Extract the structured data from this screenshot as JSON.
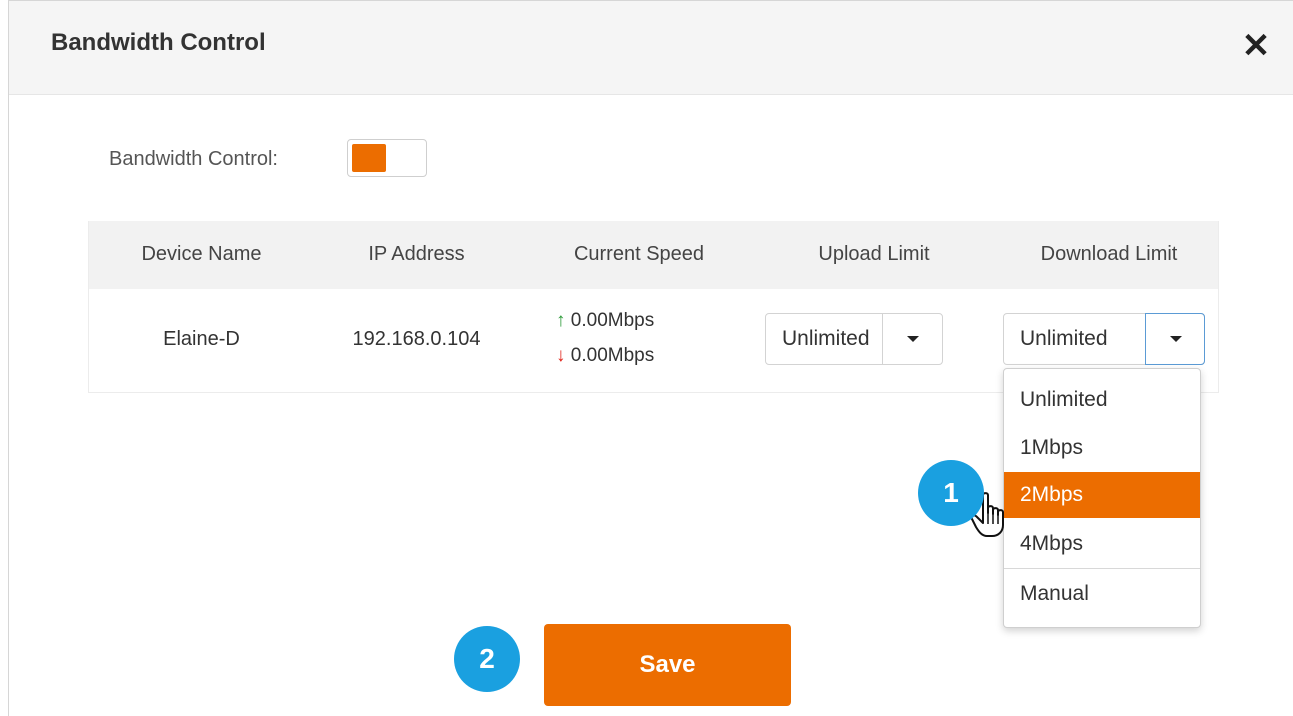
{
  "dialog": {
    "title": "Bandwidth Control",
    "close_icon": "close-icon"
  },
  "settings": {
    "bandwidth_label": "Bandwidth Control:",
    "toggle_state": "on",
    "accent_color": "#ec6d00"
  },
  "table": {
    "headers": [
      "Device Name",
      "IP Address",
      "Current Speed",
      "Upload Limit",
      "Download Limit"
    ],
    "rows": [
      {
        "device_name": "Elaine-D",
        "ip_address": "192.168.0.104",
        "upload_speed": "0.00Mbps",
        "download_speed": "0.00Mbps",
        "upload_limit": "Unlimited",
        "download_limit": "Unlimited"
      }
    ]
  },
  "dropdown": {
    "options": [
      "Unlimited",
      "1Mbps",
      "2Mbps",
      "4Mbps",
      "Manual"
    ],
    "highlighted": "2Mbps"
  },
  "annotations": {
    "step1": "1",
    "step2": "2",
    "badge_color": "#1aa0e0"
  },
  "footer": {
    "save_label": "Save"
  }
}
